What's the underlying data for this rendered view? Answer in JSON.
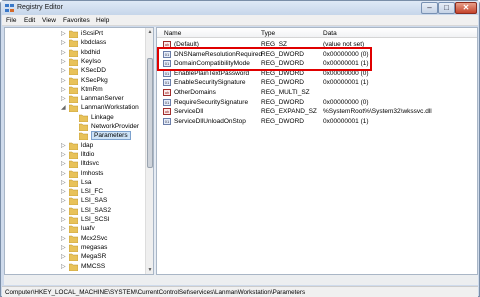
{
  "window": {
    "title": "Registry Editor"
  },
  "menu": [
    "File",
    "Edit",
    "View",
    "Favorites",
    "Help"
  ],
  "tree": [
    {
      "label": "iScsiPrt",
      "exp": "▷",
      "indent": 0
    },
    {
      "label": "kbdclass",
      "exp": "▷",
      "indent": 0
    },
    {
      "label": "kbdhid",
      "exp": "▷",
      "indent": 0
    },
    {
      "label": "KeyIso",
      "exp": "▷",
      "indent": 0
    },
    {
      "label": "KSecDD",
      "exp": "▷",
      "indent": 0
    },
    {
      "label": "KSecPkg",
      "exp": "▷",
      "indent": 0
    },
    {
      "label": "KtmRm",
      "exp": "▷",
      "indent": 0
    },
    {
      "label": "LanmanServer",
      "exp": "▷",
      "indent": 0
    },
    {
      "label": "LanmanWorkstation",
      "exp": "◢",
      "indent": 0
    },
    {
      "label": "Linkage",
      "exp": "",
      "indent": 1
    },
    {
      "label": "NetworkProvider",
      "exp": "",
      "indent": 1
    },
    {
      "label": "Parameters",
      "exp": "",
      "indent": 1,
      "selected": true
    },
    {
      "label": "ldap",
      "exp": "▷",
      "indent": 0
    },
    {
      "label": "lltdio",
      "exp": "▷",
      "indent": 0
    },
    {
      "label": "lltdsvc",
      "exp": "▷",
      "indent": 0
    },
    {
      "label": "lmhosts",
      "exp": "▷",
      "indent": 0
    },
    {
      "label": "Lsa",
      "exp": "▷",
      "indent": 0
    },
    {
      "label": "LSI_FC",
      "exp": "▷",
      "indent": 0
    },
    {
      "label": "LSI_SAS",
      "exp": "▷",
      "indent": 0
    },
    {
      "label": "LSI_SAS2",
      "exp": "▷",
      "indent": 0
    },
    {
      "label": "LSI_SCSI",
      "exp": "▷",
      "indent": 0
    },
    {
      "label": "luafv",
      "exp": "▷",
      "indent": 0
    },
    {
      "label": "Mcx2Svc",
      "exp": "▷",
      "indent": 0
    },
    {
      "label": "megasas",
      "exp": "▷",
      "indent": 0
    },
    {
      "label": "MegaSR",
      "exp": "▷",
      "indent": 0
    },
    {
      "label": "MMCSS",
      "exp": "▷",
      "indent": 0
    }
  ],
  "columns": {
    "name": "Name",
    "type": "Type",
    "data": "Data"
  },
  "values": [
    {
      "name": "(Default)",
      "type": "REG_SZ",
      "data": "(value not set)",
      "icon": "ab",
      "str": true
    },
    {
      "name": "DNSNameResolutionRequired",
      "type": "REG_DWORD",
      "data": "0x00000000 (0)",
      "icon": "01"
    },
    {
      "name": "DomainCompatibilityMode",
      "type": "REG_DWORD",
      "data": "0x00000001 (1)",
      "icon": "01"
    },
    {
      "name": "EnablePlainTextPassword",
      "type": "REG_DWORD",
      "data": "0x00000000 (0)",
      "icon": "01"
    },
    {
      "name": "EnableSecuritySignature",
      "type": "REG_DWORD",
      "data": "0x00000001 (1)",
      "icon": "01"
    },
    {
      "name": "OtherDomains",
      "type": "REG_MULTI_SZ",
      "data": "",
      "icon": "ab",
      "str": true
    },
    {
      "name": "RequireSecuritySignature",
      "type": "REG_DWORD",
      "data": "0x00000000 (0)",
      "icon": "01"
    },
    {
      "name": "ServiceDll",
      "type": "REG_EXPAND_SZ",
      "data": "%SystemRoot%\\System32\\wkssvc.dll",
      "icon": "ab",
      "str": true
    },
    {
      "name": "ServiceDllUnloadOnStop",
      "type": "REG_DWORD",
      "data": "0x00000001 (1)",
      "icon": "01"
    }
  ],
  "status": "Computer\\HKEY_LOCAL_MACHINE\\SYSTEM\\CurrentControlSet\\services\\LanmanWorkstation\\Parameters",
  "colors": {
    "highlight": "#e00000",
    "folder": "#e8c25a"
  }
}
